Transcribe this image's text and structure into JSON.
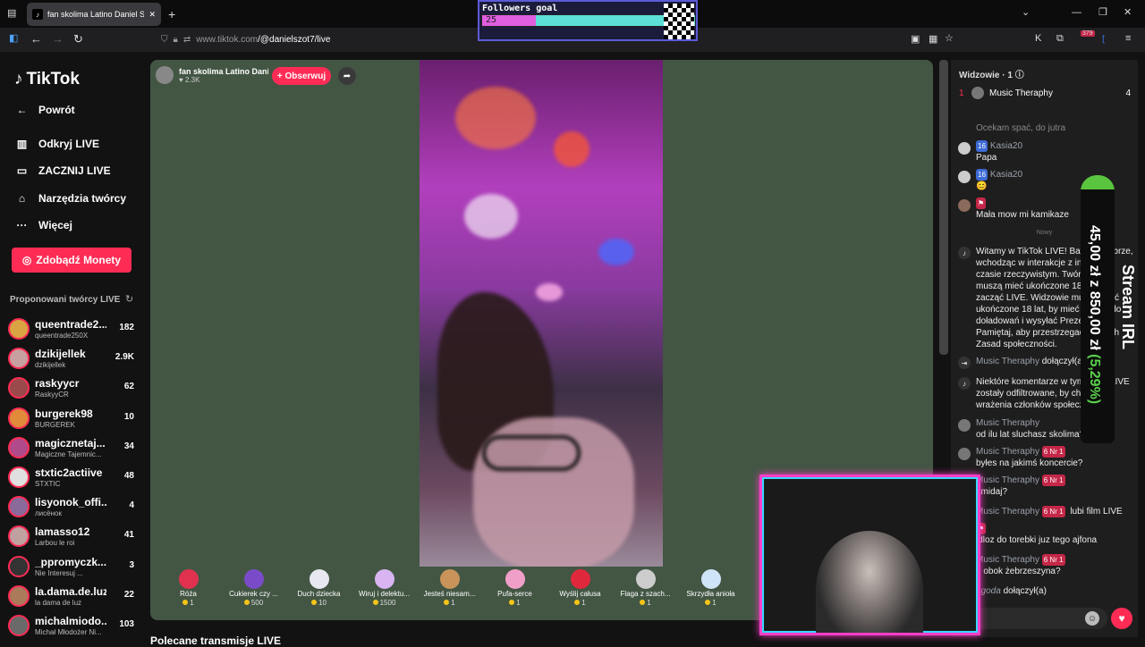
{
  "browser": {
    "tab_title": "fan skolima Latino Daniel S",
    "url_domain": "www.tiktok.com",
    "url_path": "/@danielszot7/live",
    "ext_badge": "379"
  },
  "followers_goal": {
    "title": "Followers goal",
    "current": "25",
    "target": "100",
    "progress": 0.25
  },
  "sidebar": {
    "logo": "TikTok",
    "back": "Powrót",
    "menu": [
      {
        "label": "Odkryj LIVE",
        "icon": "calendar-icon"
      },
      {
        "label": "ZACZNIJ LIVE",
        "icon": "camera-icon"
      },
      {
        "label": "Narzędzia twórcy",
        "icon": "home-icon"
      },
      {
        "label": "Więcej",
        "icon": "more-icon"
      }
    ],
    "coins_button": "Zdobądź Monety",
    "suggested_header": "Proponowani twórcy LIVE",
    "creators": [
      {
        "name": "queentrade2...",
        "sub": "queentrade250X",
        "count": "182"
      },
      {
        "name": "dzikijellek",
        "sub": "dzikijellek",
        "count": "2.9K"
      },
      {
        "name": "raskyycr",
        "sub": "RaskyyCR",
        "count": "62"
      },
      {
        "name": "burgerek98",
        "sub": "BURGEREK",
        "count": "10"
      },
      {
        "name": "magicznetaj...",
        "sub": "Magiczne Tajemnic...",
        "count": "34"
      },
      {
        "name": "stxtic2actiive",
        "sub": "STXTIC",
        "count": "48"
      },
      {
        "name": "lisyonok_offi...",
        "sub": "лисёнок",
        "count": "4"
      },
      {
        "name": "lamasso12",
        "sub": "Larbou le roi",
        "count": "41"
      },
      {
        "name": "_ppromyczk...",
        "sub": "Nie Interesuj ...",
        "count": "3"
      },
      {
        "name": "la.dama.de.luz",
        "sub": "la dama de luz",
        "count": "22"
      },
      {
        "name": "michalmiodo...",
        "sub": "Michał Młodożer Ni...",
        "count": "103"
      }
    ]
  },
  "stream": {
    "host_name": "fan skolima Latino Dani...",
    "likes": "2.3K",
    "follow_label": "+ Obserwuj",
    "below_title": "Polecane transmisje LIVE"
  },
  "gifts": [
    {
      "name": "Róża",
      "price": "1",
      "color": "#e0314f"
    },
    {
      "name": "Cukierek czy ...",
      "price": "500",
      "color": "#7a4bc8"
    },
    {
      "name": "Duch dziecka",
      "price": "10",
      "color": "#e8e8f0"
    },
    {
      "name": "Wiruj i delektu...",
      "price": "1500",
      "color": "#d8b5f0"
    },
    {
      "name": "Jesteś niesam...",
      "price": "1",
      "color": "#c8945a"
    },
    {
      "name": "Pufa-serce",
      "price": "1",
      "color": "#f0a0c8"
    },
    {
      "name": "Wyślij całusa",
      "price": "1",
      "color": "#e0283c"
    },
    {
      "name": "Flaga z szach...",
      "price": "1",
      "color": "#cccccc"
    },
    {
      "name": "Skrzydła anioła",
      "price": "1",
      "color": "#d0e4f8"
    }
  ],
  "chat": {
    "viewers_label": "Widzowie",
    "viewers_count": "1",
    "top_viewer": {
      "rank": "1",
      "name": "Music Theraphy",
      "count": "4"
    },
    "partial_line": "Ocekam spać, do jutra",
    "new_label": "Nowy",
    "messages": [
      {
        "user": "Kasia20",
        "badge": "16",
        "text": "Papa"
      },
      {
        "user": "Kasia20",
        "badge": "16",
        "text": "😊"
      },
      {
        "user": "",
        "badge": "",
        "text": "Mała mow mi kamikaze"
      }
    ],
    "system1": "Witamy w TikTok LIVE! Baw się dobrze, wchodząc w interakcje z innymi w czasie rzeczywistym. Twórcy LIVE muszą mieć ukończone 18 lat, aby zacząć LIVE. Widzowie muszą mieć ukończone 18 lat, by mieć dostęp do doładowań i wysyłać Prezenty. Pamiętaj, aby przestrzegać naszych Zasad społeczności.",
    "joined1_user": "Music Theraphy",
    "joined_text": "dołączył(a)",
    "system2": "Niektóre komentarze w tym filmie LIVE zostały odfiltrowane, by chronić wrażenia członków społeczności.",
    "music_msgs": [
      {
        "user": "Music Theraphy",
        "badge": "",
        "text": "od ilu lat sluchasz skolima?"
      },
      {
        "user": "Music Theraphy",
        "badge": "6 Nr 1",
        "text": "byłes na jakimś koncercie?"
      },
      {
        "user": "Music Theraphy",
        "badge": "6 Nr 1",
        "text": "amidaj?"
      },
      {
        "user": "Music Theraphy",
        "badge": "6 Nr 1",
        "text": "lubi film LIVE"
      },
      {
        "user": "",
        "badge": "",
        "text": "idloz do torebki juz tego ajfona"
      },
      {
        "user": "Music Theraphy",
        "badge": "6 Nr 1",
        "text": "n obok żebrzeszyna?"
      }
    ],
    "last_join_user": "agoda",
    "last_join_text": "dołączył(a)"
  },
  "irl_overlay": {
    "amount": "45,00 zł z 850,00 zł",
    "percent": "(5,29%)",
    "title": "Stream IRL"
  }
}
